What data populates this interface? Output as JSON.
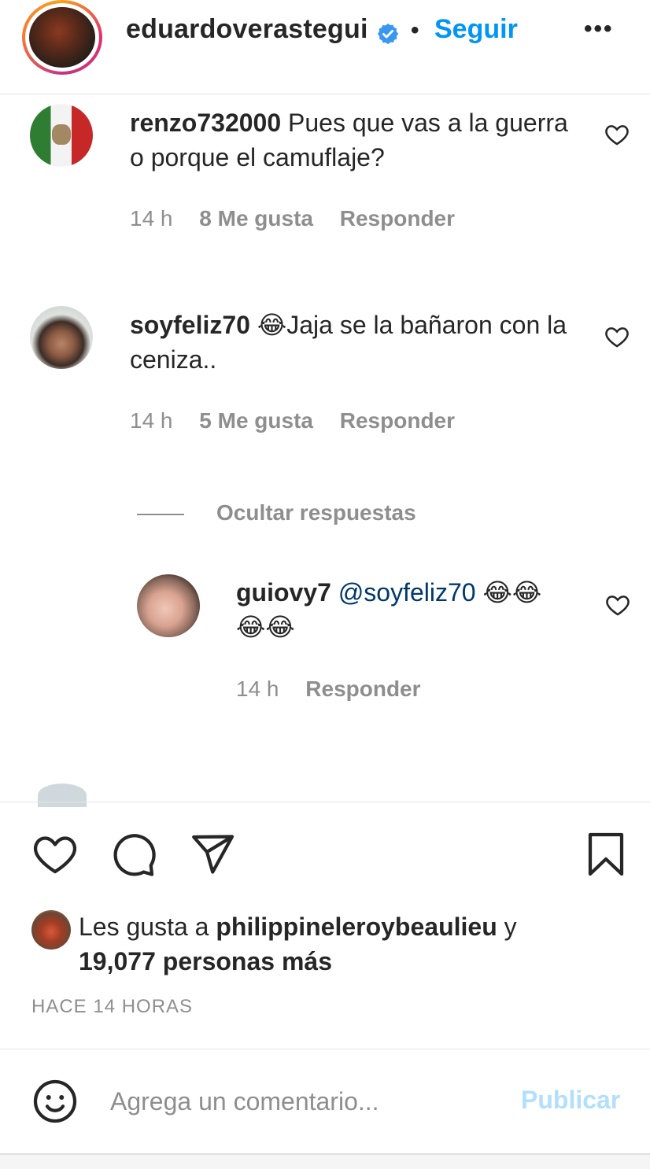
{
  "header": {
    "username": "eduardoverastegui",
    "separator": "•",
    "follow_label": "Seguir",
    "more_icon": "more-horizontal-icon"
  },
  "comments": [
    {
      "username": "renzo732000",
      "text": "Pues que vas a la guerra o porque el camuflaje?",
      "time": "14 h",
      "likes": "8 Me gusta",
      "reply_label": "Responder"
    },
    {
      "username": "soyfeliz70",
      "text": "😂Jaja se la bañaron con la ceniza..",
      "time": "14 h",
      "likes": "5 Me gusta",
      "reply_label": "Responder",
      "hide_replies_label": "Ocultar respuestas",
      "replies": [
        {
          "username": "guiovy7",
          "mention": "@soyfeliz70",
          "text": "😂😂😂😂",
          "time": "14 h",
          "reply_label": "Responder"
        }
      ]
    }
  ],
  "actions": {
    "like_icon": "heart-icon",
    "comment_icon": "comment-icon",
    "share_icon": "send-icon",
    "save_icon": "bookmark-icon"
  },
  "likes_summary": {
    "prefix": "Les gusta a",
    "liker": "philippineleroybeaulieu",
    "conjunction": "y",
    "others": "19,077 personas más"
  },
  "posted_ago": "HACE 14 HORAS",
  "comment_box": {
    "placeholder": "Agrega un comentario...",
    "publish_label": "Publicar"
  },
  "colors": {
    "link_blue": "#0095f6",
    "publish_disabled": "#b2dffc",
    "muted": "#8e8e8e",
    "text": "#262626"
  }
}
